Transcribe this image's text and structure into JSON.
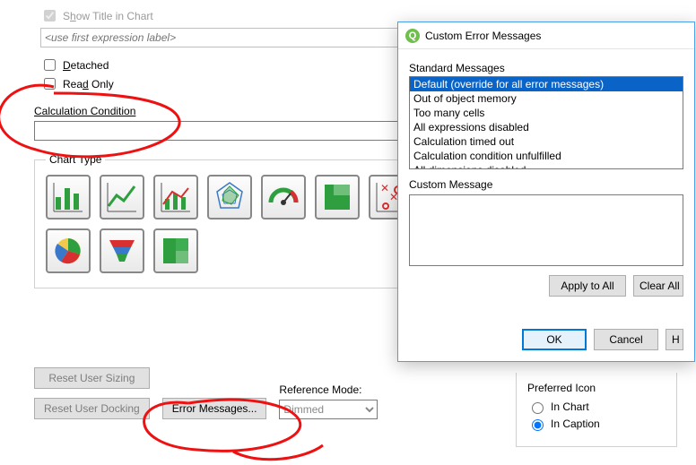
{
  "showTitle": {
    "label_pre": "S",
    "label_u": "h",
    "label_post": "ow Title in Chart",
    "checked": true
  },
  "exprPlaceholder": "<use first expression label>",
  "detached": {
    "label_u": "D",
    "label_post": "etached"
  },
  "readOnly": {
    "label_pre": "Rea",
    "label_u": "d",
    "label_post": " Only"
  },
  "calcConditionLabel": "Calculation Condition",
  "chartTypeLegend": "Chart Type",
  "buttons": {
    "resetSizing": "Reset User Sizing",
    "resetDocking": "Reset User Docking",
    "errorMessages": "Error Messages..."
  },
  "referenceMode": {
    "label": "Reference Mode:",
    "value": "Dimmed"
  },
  "preferredIcon": {
    "title": "Preferred Icon",
    "opt1": "In Chart",
    "opt2": "In Caption",
    "selected": "In Caption"
  },
  "modal": {
    "title": "Custom Error Messages",
    "stdLabel": "Standard Messages",
    "items": [
      "Default (override for all error messages)",
      "Out of object memory",
      "Too many cells",
      "All expressions disabled",
      "Calculation timed out",
      "Calculation condition unfulfilled",
      "All dimensions disabled."
    ],
    "selectedIndex": 0,
    "customLabel": "Custom Message",
    "applyAll": "Apply to All",
    "clearAll": "Clear All",
    "ok": "OK",
    "cancel": "Cancel",
    "help": "H"
  }
}
